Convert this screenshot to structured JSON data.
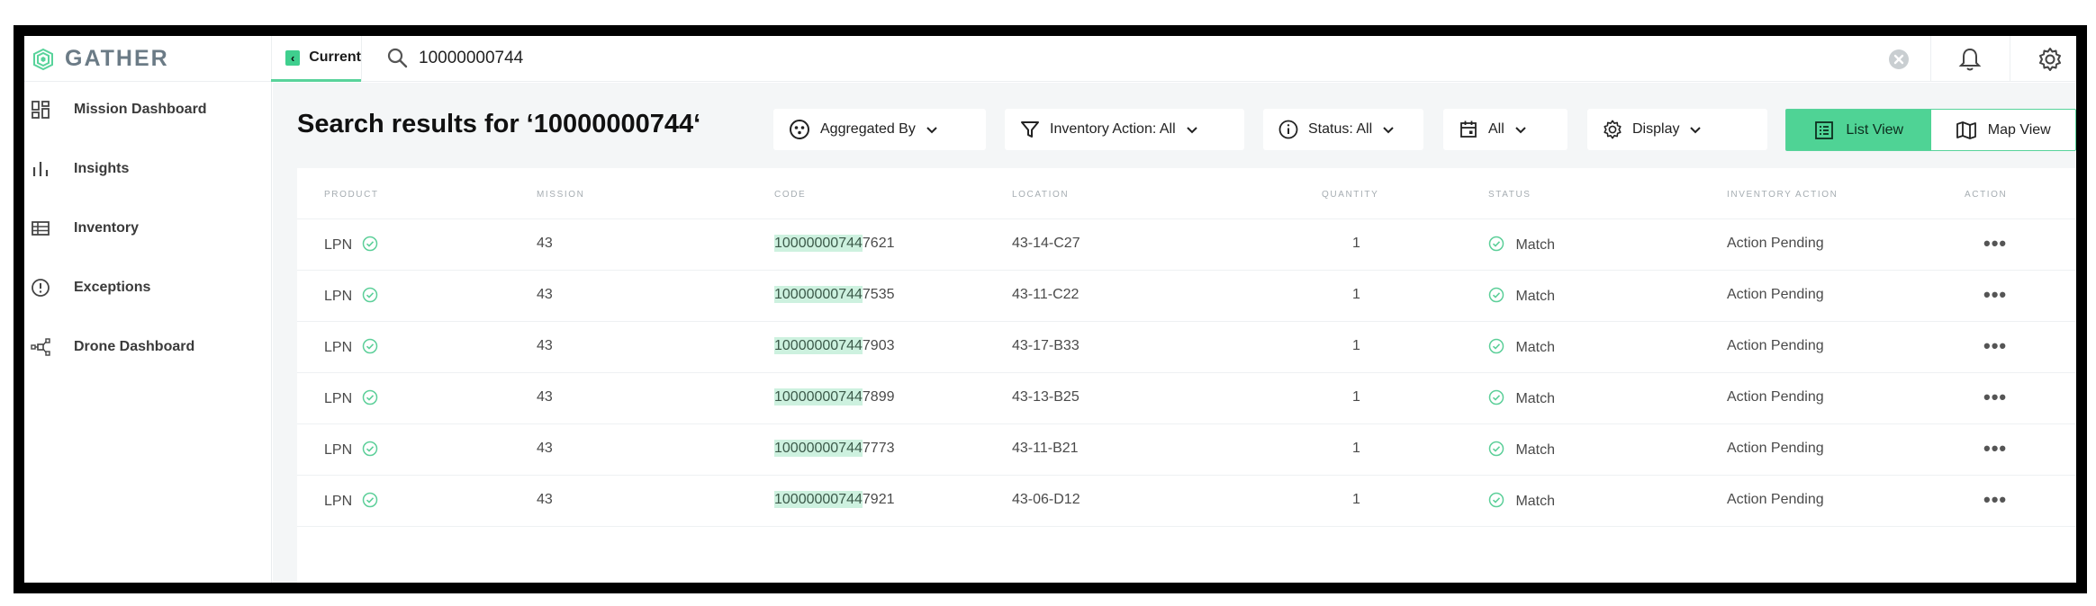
{
  "app": {
    "brand": "GATHER"
  },
  "topbar": {
    "current_tab": "Current",
    "search_value": "10000000744"
  },
  "sidebar": {
    "items": [
      {
        "label": "Mission Dashboard",
        "icon": "dashboard-icon"
      },
      {
        "label": "Insights",
        "icon": "bar-chart-icon"
      },
      {
        "label": "Inventory",
        "icon": "table-icon"
      },
      {
        "label": "Exceptions",
        "icon": "alert-circle-icon"
      },
      {
        "label": "Drone Dashboard",
        "icon": "drone-icon"
      }
    ]
  },
  "main": {
    "title": "Search results for ‘10000000744‘",
    "toolbar": {
      "aggregated_by": "Aggregated By",
      "inventory_action": "Inventory Action: All",
      "status": "Status: All",
      "date": "All",
      "display": "Display"
    },
    "view_toggle": {
      "list": "List View",
      "map": "Map View",
      "active": "list"
    }
  },
  "table": {
    "columns": [
      "PRODUCT",
      "MISSION",
      "CODE",
      "LOCATION",
      "QUANTITY",
      "STATUS",
      "INVENTORY ACTION",
      "ACTION"
    ],
    "rows": [
      {
        "product": "LPN",
        "mission": "43",
        "code_match": "10000000744",
        "code_rest": "7621",
        "location": "43-14-C27",
        "quantity": "1",
        "status": "Match",
        "inventory_action": "Action Pending"
      },
      {
        "product": "LPN",
        "mission": "43",
        "code_match": "10000000744",
        "code_rest": "7535",
        "location": "43-11-C22",
        "quantity": "1",
        "status": "Match",
        "inventory_action": "Action Pending"
      },
      {
        "product": "LPN",
        "mission": "43",
        "code_match": "10000000744",
        "code_rest": "7903",
        "location": "43-17-B33",
        "quantity": "1",
        "status": "Match",
        "inventory_action": "Action Pending"
      },
      {
        "product": "LPN",
        "mission": "43",
        "code_match": "10000000744",
        "code_rest": "7899",
        "location": "43-13-B25",
        "quantity": "1",
        "status": "Match",
        "inventory_action": "Action Pending"
      },
      {
        "product": "LPN",
        "mission": "43",
        "code_match": "10000000744",
        "code_rest": "7773",
        "location": "43-11-B21",
        "quantity": "1",
        "status": "Match",
        "inventory_action": "Action Pending"
      },
      {
        "product": "LPN",
        "mission": "43",
        "code_match": "10000000744",
        "code_rest": "7921",
        "location": "43-06-D12",
        "quantity": "1",
        "status": "Match",
        "inventory_action": "Action Pending"
      }
    ],
    "row_action": "•••"
  },
  "colors": {
    "accent": "#4fd395",
    "match_icon": "#5ccf99",
    "code_highlight": "#cdf1df"
  }
}
